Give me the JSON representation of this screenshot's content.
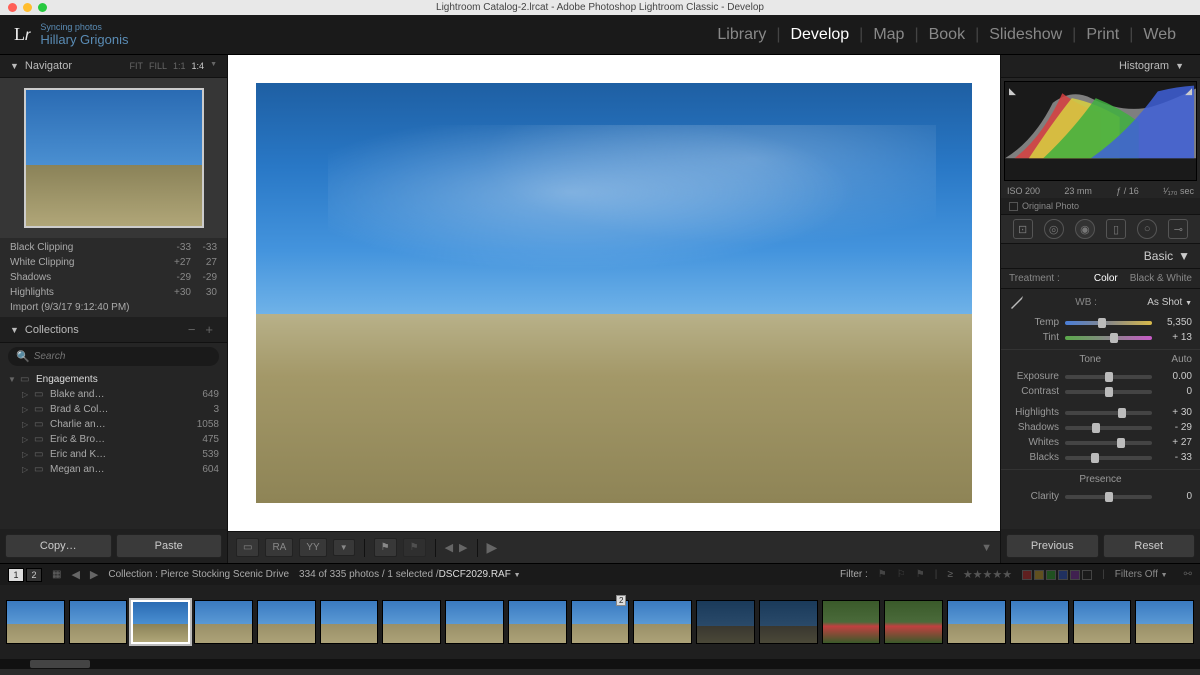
{
  "titlebar": "Lightroom Catalog-2.lrcat - Adobe Photoshop Lightroom Classic - Develop",
  "topbar": {
    "logo": "Lr",
    "sync_status": "Syncing photos",
    "username": "Hillary Grigonis",
    "modules": [
      "Library",
      "Develop",
      "Map",
      "Book",
      "Slideshow",
      "Print",
      "Web"
    ],
    "active_module": "Develop"
  },
  "navigator": {
    "title": "Navigator",
    "zoom_options": [
      "FIT",
      "FILL",
      "1:1",
      "1:4"
    ]
  },
  "history": [
    {
      "name": "Black Clipping",
      "v1": "-33",
      "v2": "-33"
    },
    {
      "name": "White Clipping",
      "v1": "+27",
      "v2": "27"
    },
    {
      "name": "Shadows",
      "v1": "-29",
      "v2": "-29"
    },
    {
      "name": "Highlights",
      "v1": "+30",
      "v2": "30"
    },
    {
      "name": "Import (9/3/17 9:12:40 PM)",
      "v1": "",
      "v2": ""
    }
  ],
  "collections": {
    "title": "Collections",
    "search_placeholder": "Search",
    "parent": "Engagements",
    "items": [
      {
        "name": "Blake and…",
        "count": "649"
      },
      {
        "name": "Brad & Col…",
        "count": "3"
      },
      {
        "name": "Charlie an…",
        "count": "1058"
      },
      {
        "name": "Eric & Bro…",
        "count": "475"
      },
      {
        "name": "Eric and K…",
        "count": "539"
      },
      {
        "name": "Megan an…",
        "count": "604"
      }
    ]
  },
  "left_buttons": {
    "copy": "Copy…",
    "paste": "Paste"
  },
  "center_toolbar": {
    "loupe": "☐",
    "compare1": "RA",
    "compare2": "YY",
    "flag": "⚑"
  },
  "histogram": {
    "title": "Histogram",
    "iso": "ISO 200",
    "focal": "23 mm",
    "aperture": "ƒ / 16",
    "shutter": "¹⁄₁₇₀ sec",
    "original": "Original Photo"
  },
  "basic": {
    "title": "Basic",
    "treatment_label": "Treatment :",
    "treatment_color": "Color",
    "treatment_bw": "Black & White",
    "wb_label": "WB :",
    "wb_value": "As Shot",
    "temp_label": "Temp",
    "temp_value": "5,350",
    "tint_label": "Tint",
    "tint_value": "+ 13",
    "tone_label": "Tone",
    "auto_label": "Auto",
    "sliders": [
      {
        "label": "Exposure",
        "value": "0.00",
        "pos": 50
      },
      {
        "label": "Contrast",
        "value": "0",
        "pos": 50
      },
      {
        "label": "Highlights",
        "value": "+ 30",
        "pos": 65
      },
      {
        "label": "Shadows",
        "value": "- 29",
        "pos": 36
      },
      {
        "label": "Whites",
        "value": "+ 27",
        "pos": 64
      },
      {
        "label": "Blacks",
        "value": "- 33",
        "pos": 34
      }
    ],
    "presence_label": "Presence",
    "clarity_label": "Clarity",
    "clarity_value": "0"
  },
  "right_buttons": {
    "previous": "Previous",
    "reset": "Reset"
  },
  "filmstrip_bar": {
    "pages": [
      "1",
      "2"
    ],
    "collection_label": "Collection : Pierce Stocking Scenic Drive",
    "count": "334 of 335 photos / 1 selected /",
    "filename": "DSCF2029.RAF",
    "filter_label": "Filter :",
    "filters_off": "Filters Off"
  }
}
